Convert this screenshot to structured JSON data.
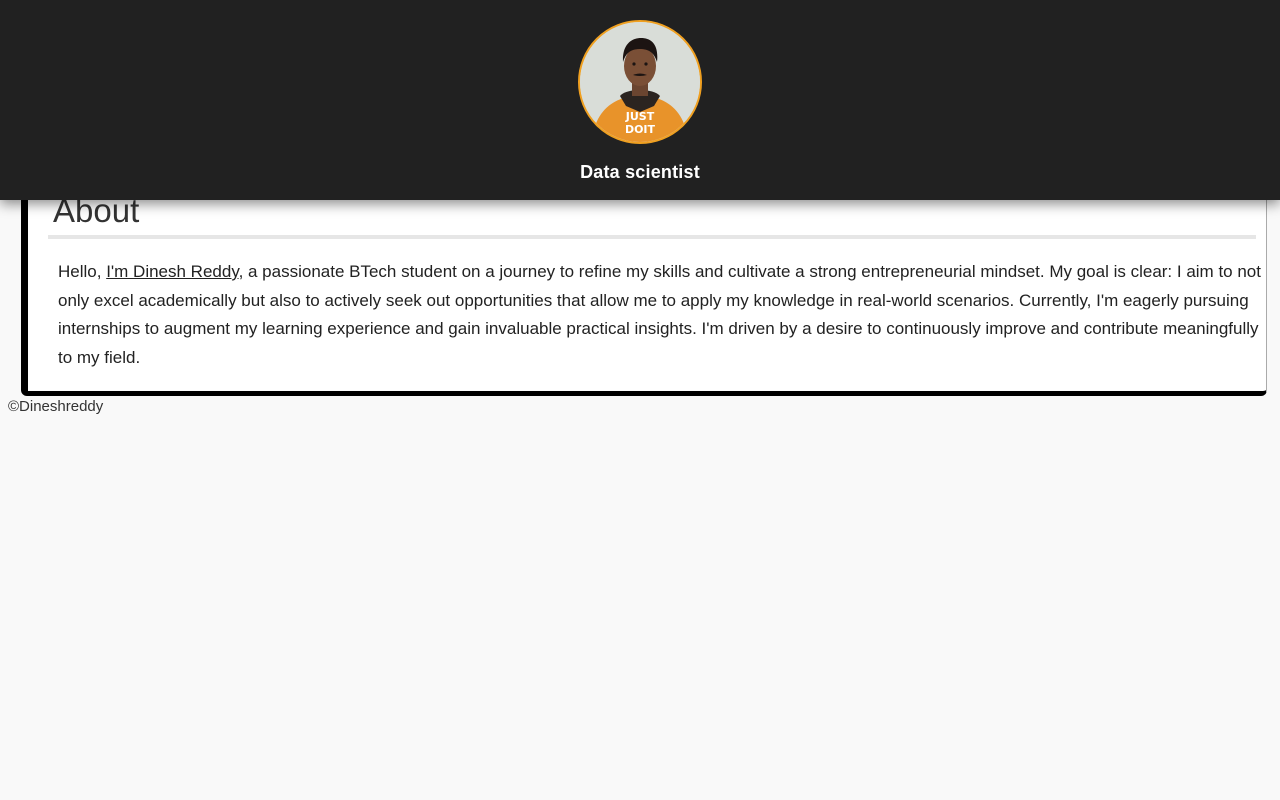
{
  "header": {
    "avatar_alt": "Profile photo",
    "role": "Data scientist"
  },
  "about": {
    "title": "About",
    "greeting": "Hello, ",
    "name_link": "I'm Dinesh Reddy",
    "body": ", a passionate BTech student on a journey to refine my skills and cultivate a strong entrepreneurial mindset. My goal is clear: I aim to not only excel academically but also to actively seek out opportunities that allow me to apply my knowledge in real-world scenarios. Currently, I'm eagerly pursuing internships to augment my learning experience and gain invaluable practical insights. I'm driven by a desire to continuously improve and contribute meaningfully to my field."
  },
  "footer": {
    "copyright": "©Dineshreddy"
  },
  "colors": {
    "header_bg": "#212121",
    "avatar_ring": "#f0a020",
    "page_bg": "#f9f9f9",
    "card_accent": "#000000"
  }
}
